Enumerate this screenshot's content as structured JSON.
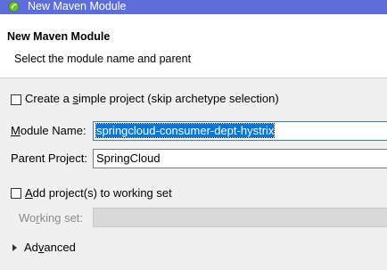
{
  "window": {
    "title": "New Maven Module",
    "icon": "eclipse-leaf-icon"
  },
  "banner": {
    "title": "New Maven Module",
    "description": "Select the module name and parent"
  },
  "simple_project": {
    "label_before": "Create a ",
    "label_mnemonic": "s",
    "label_after": "imple project (skip archetype selection)",
    "checked": false
  },
  "module_name": {
    "label_mnemonic": "M",
    "label_after": "odule Name:",
    "value": "springcloud-consumer-dept-hystrix"
  },
  "parent_project": {
    "label": "Parent Project:",
    "value": "SpringCloud"
  },
  "working_set": {
    "checkbox_label_mnemonic": "A",
    "checkbox_label_after": "dd project(s) to working set",
    "checked": false,
    "field_label_before": "Wo",
    "field_label_mnemonic": "r",
    "field_label_after": "king set:",
    "value": ""
  },
  "advanced": {
    "label_before": "Ad",
    "label_mnemonic": "v",
    "label_after": "anced"
  },
  "colors": {
    "titlebar": "#5d6edb",
    "selection": "#0078d7",
    "dialog_bg": "#f0f0f0"
  }
}
